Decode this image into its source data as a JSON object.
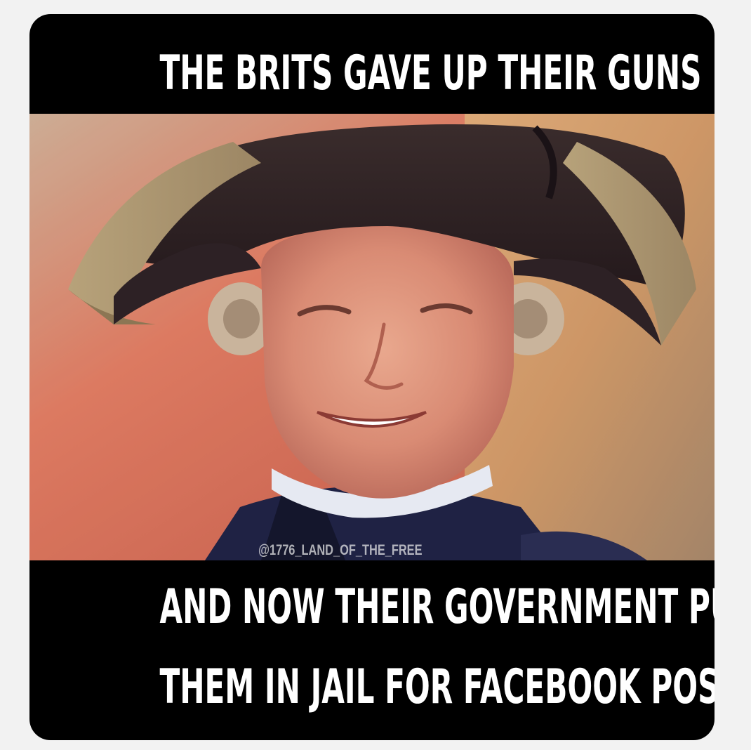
{
  "meme": {
    "top_caption": "THE BRITS GAVE UP THEIR GUNS",
    "bottom_caption_line1": "AND NOW THEIR GOVERNMENT PUTS",
    "bottom_caption_line2": "THEM IN JAIL FOR FACEBOOK POSTS",
    "watermark": "@1776_LAND_OF_THE_FREE"
  },
  "colors": {
    "background": "#f2f2f2",
    "frame": "#000000",
    "caption_text": "#ffffff"
  },
  "photo": {
    "subject": "smiling man in a tricorn hat and powdered wig"
  }
}
